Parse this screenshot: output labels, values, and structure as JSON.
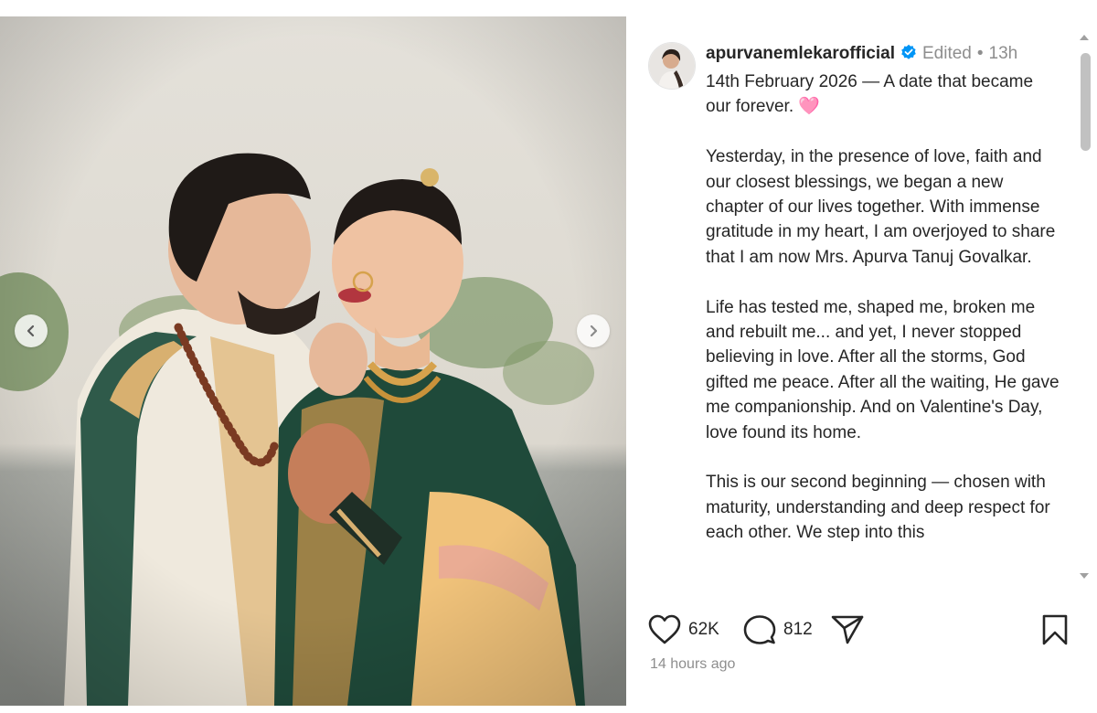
{
  "post": {
    "username": "apurvanemlekarofficial",
    "edited_label": "Edited",
    "separator": "•",
    "age_short": "13h",
    "caption": [
      "14th February 2026 — A date that became our forever. 🩷",
      "Yesterday, in the presence of love, faith and our closest blessings, we began a new chapter of our lives together. With immense gratitude in my heart, I am overjoyed to share that I am now Mrs. Apurva Tanuj Govalkar.",
      "Life has tested me, shaped me, broken me and rebuilt me... and yet, I never stopped believing in love. After all the storms, God gifted me peace. After all the waiting, He gave me companionship. And on Valentine's Day, love found its home.",
      "This is our second beginning — chosen with maturity, understanding and deep respect for each other. We step into this"
    ],
    "likes": "62K",
    "comments": "812",
    "timestamp": "14 hours ago"
  },
  "icons": {
    "verified": "verified-badge-icon",
    "prev": "chevron-left-icon",
    "next": "chevron-right-icon",
    "like": "heart-icon",
    "comment": "comment-icon",
    "share": "send-icon",
    "save": "bookmark-icon"
  },
  "colors": {
    "verified": "#0095f6",
    "muted": "#8e8e8e",
    "text": "#262626"
  }
}
